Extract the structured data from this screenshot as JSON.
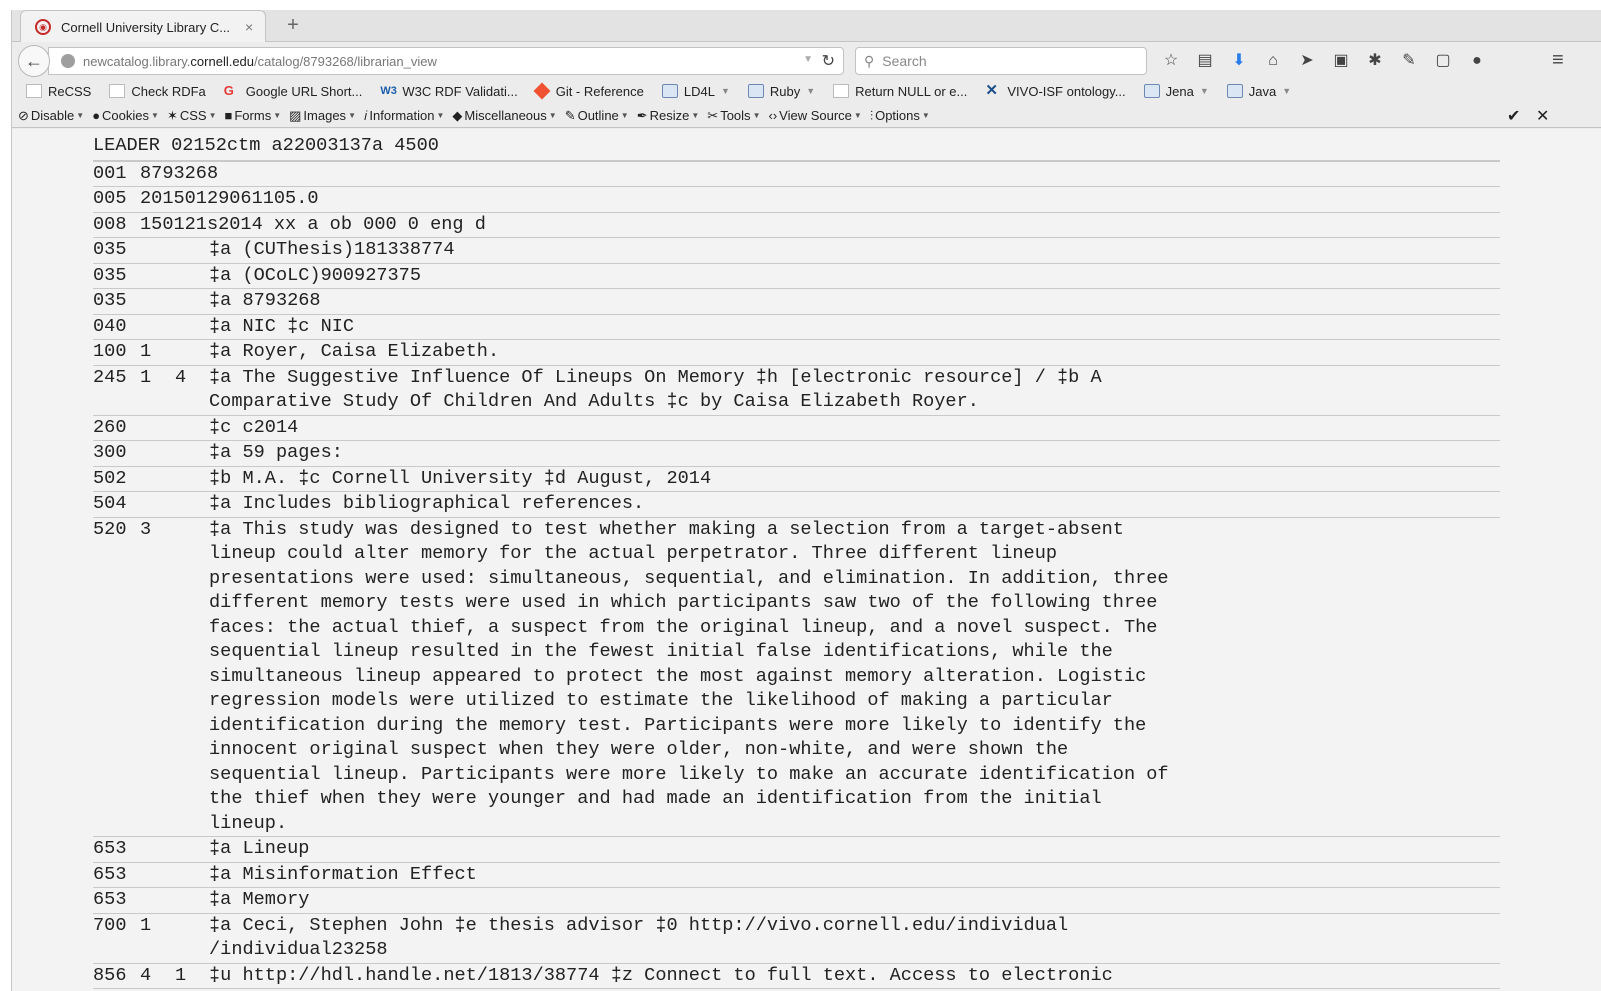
{
  "browser": {
    "tab_title": "Cornell University Library C...",
    "tab_close": "×",
    "new_tab": "+",
    "url_prefix": "newcatalog.library.",
    "url_domain": "cornell.edu",
    "url_path": "/catalog/8793268/librarian_view",
    "search_placeholder": "Search"
  },
  "bookmarks": [
    {
      "label": "ReCSS",
      "icon": "page"
    },
    {
      "label": "Check RDFa",
      "icon": "page"
    },
    {
      "label": "Google URL Short...",
      "icon": "google"
    },
    {
      "label": "W3C RDF Validati...",
      "icon": "w3c"
    },
    {
      "label": "Git - Reference",
      "icon": "git"
    },
    {
      "label": "LD4L",
      "icon": "folder"
    },
    {
      "label": "Ruby",
      "icon": "folder"
    },
    {
      "label": "Return NULL or e...",
      "icon": "page"
    },
    {
      "label": "VIVO-ISF ontology...",
      "icon": "vivo"
    },
    {
      "label": "Jena",
      "icon": "folder"
    },
    {
      "label": "Java",
      "icon": "folder"
    }
  ],
  "devtools": [
    "Disable",
    "Cookies",
    "CSS",
    "Forms",
    "Images",
    "Information",
    "Miscellaneous",
    "Outline",
    "Resize",
    "Tools",
    "View Source",
    "Options"
  ],
  "record": {
    "leader": "LEADER 02152ctm a22003137a 4500",
    "control_fields": [
      {
        "tag": "001",
        "value": "8793268"
      },
      {
        "tag": "005",
        "value": "20150129061105.0"
      },
      {
        "tag": "008",
        "value": "150121s2014 xx a ob 000 0 eng d"
      }
    ],
    "data_fields": [
      {
        "tag": "035",
        "ind1": "",
        "ind2": "",
        "text": "‡a (CUThesis)181338774"
      },
      {
        "tag": "035",
        "ind1": "",
        "ind2": "",
        "text": "‡a (OCoLC)900927375"
      },
      {
        "tag": "035",
        "ind1": "",
        "ind2": "",
        "text": "‡a 8793268"
      },
      {
        "tag": "040",
        "ind1": "",
        "ind2": "",
        "text": "‡a NIC ‡c NIC"
      },
      {
        "tag": "100",
        "ind1": "1",
        "ind2": "",
        "text": "‡a Royer, Caisa Elizabeth."
      },
      {
        "tag": "245",
        "ind1": "1",
        "ind2": "4",
        "text": "‡a The Suggestive Influence Of Lineups On Memory ‡h [electronic resource] / ‡b A Comparative Study Of Children And Adults ‡c by Caisa Elizabeth Royer."
      },
      {
        "tag": "260",
        "ind1": "",
        "ind2": "",
        "text": "‡c c2014"
      },
      {
        "tag": "300",
        "ind1": "",
        "ind2": "",
        "text": "‡a 59 pages:"
      },
      {
        "tag": "502",
        "ind1": "",
        "ind2": "",
        "text": "‡b M.A. ‡c Cornell University ‡d August, 2014"
      },
      {
        "tag": "504",
        "ind1": "",
        "ind2": "",
        "text": "‡a Includes bibliographical references."
      },
      {
        "tag": "520",
        "ind1": "3",
        "ind2": "",
        "text": "‡a This study was designed to test whether making a selection from a target-absent lineup could alter memory for the actual perpetrator. Three different lineup presentations were used: simultaneous, sequential, and elimination. In addition, three different memory tests were used in which participants saw two of the following three faces: the actual thief, a suspect from the original lineup, and a novel suspect. The sequential lineup resulted in the fewest initial false identifications, while the simultaneous lineup appeared to protect the most against memory alteration. Logistic regression models were utilized to estimate the likelihood of making a particular identification during the memory test. Participants were more likely to identify the innocent original suspect when they were older, non-white, and were shown the sequential lineup. Participants were more likely to make an accurate identification of the thief when they were younger and had made an identification from the initial lineup."
      },
      {
        "tag": "653",
        "ind1": "",
        "ind2": "",
        "text": "‡a Lineup"
      },
      {
        "tag": "653",
        "ind1": "",
        "ind2": "",
        "text": "‡a Misinformation Effect"
      },
      {
        "tag": "653",
        "ind1": "",
        "ind2": "",
        "text": "‡a Memory"
      },
      {
        "tag": "700",
        "ind1": "1",
        "ind2": "",
        "text": "‡a Ceci, Stephen John ‡e thesis advisor ‡0 http://vivo.cornell.edu/individual /individual23258"
      },
      {
        "tag": "856",
        "ind1": "4",
        "ind2": "1",
        "text": "‡u http://hdl.handle.net/1813/38774 ‡z Connect to full text. Access to electronic"
      }
    ]
  }
}
